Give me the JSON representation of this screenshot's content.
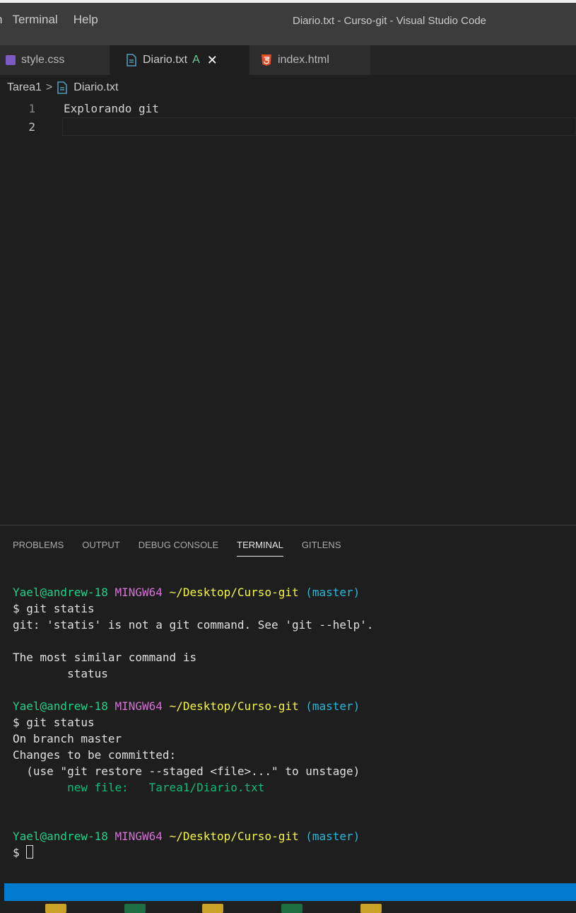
{
  "menu": {
    "partial": "n",
    "items": [
      "Terminal",
      "Help"
    ]
  },
  "window": {
    "title": "Diario.txt - Curso-git - Visual Studio Code"
  },
  "tabs": [
    {
      "label": "style.css",
      "icon": "css-file-icon"
    },
    {
      "label": "Diario.txt",
      "badge": "A",
      "icon": "text-file-icon",
      "close": "✕"
    },
    {
      "label": "index.html",
      "icon": "html5-icon"
    }
  ],
  "breadcrumb": {
    "folder": "Tarea1",
    "separator": ">",
    "file": "Diario.txt"
  },
  "editor": {
    "lines": [
      {
        "number": "1",
        "text": "Explorando git"
      },
      {
        "number": "2",
        "text": ""
      }
    ]
  },
  "panel": {
    "tabs": [
      "PROBLEMS",
      "OUTPUT",
      "DEBUG CONSOLE",
      "TERMINAL",
      "GITLENS"
    ],
    "active_tab": "TERMINAL"
  },
  "terminal": {
    "prompt": {
      "user": "Yael@andrew-18",
      "system": "MINGW64",
      "path": "~/Desktop/Curso-git",
      "branch": "(master)"
    },
    "blocks": [
      {
        "command": "$ git statis",
        "output": [
          "git: 'statis' is not a git command. See 'git --help'.",
          "",
          "The most similar command is",
          "        status"
        ]
      },
      {
        "command": "$ git status",
        "output": [
          "On branch master",
          "Changes to be committed:",
          "  (use \"git restore --staged <file>...\" to unstage)"
        ],
        "staged": "        new file:   Tarea1/Diario.txt"
      }
    ],
    "final_prompt": "$"
  },
  "colors": {
    "accent": "#007acc",
    "terminal_user": "#23d18b",
    "terminal_system": "#d670d6",
    "terminal_path": "#f5f543",
    "terminal_branch": "#29b8db",
    "new_file": "#0dbc79",
    "html_icon": "#e44d26",
    "file_icon": "#519aba"
  }
}
